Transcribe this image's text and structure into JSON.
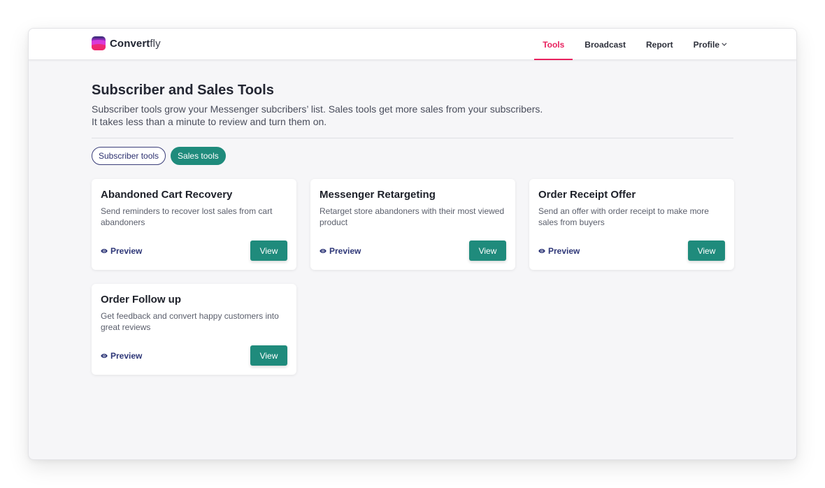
{
  "brand": {
    "name_bold": "Convert",
    "name_light": "fly",
    "logo_icon": "gradient-waves-logo"
  },
  "nav": {
    "items": [
      {
        "label": "Tools",
        "active": true
      },
      {
        "label": "Broadcast",
        "active": false
      },
      {
        "label": "Report",
        "active": false
      },
      {
        "label": "Profile",
        "active": false,
        "icon": "chevron-down-icon"
      }
    ],
    "active_color": "#e8215e"
  },
  "page": {
    "title": "Subscriber and Sales Tools",
    "description_line1": "Subscriber tools grow your Messenger subcribers’ list. Sales tools get more sales from your subscribers.",
    "description_line2": "It takes less than a minute to review and turn them on."
  },
  "filters": [
    {
      "label": "Subscriber tools",
      "selected": false
    },
    {
      "label": "Sales tools",
      "selected": true
    }
  ],
  "accent_color": "#1f8b7c",
  "cards": [
    {
      "title": "Abandoned Cart Recovery",
      "description": "Send reminders to recover lost sales from cart abandoners",
      "preview_label": "Preview",
      "view_label": "View"
    },
    {
      "title": "Messenger Retargeting",
      "description": "Retarget store abandoners with their most viewed product",
      "preview_label": "Preview",
      "view_label": "View"
    },
    {
      "title": "Order Receipt Offer",
      "description": "Send an offer with order receipt to make more sales from buyers",
      "preview_label": "Preview",
      "view_label": "View"
    },
    {
      "title": "Order Follow up",
      "description": "Get feedback and convert happy customers into great reviews",
      "preview_label": "Preview",
      "view_label": "View"
    }
  ]
}
